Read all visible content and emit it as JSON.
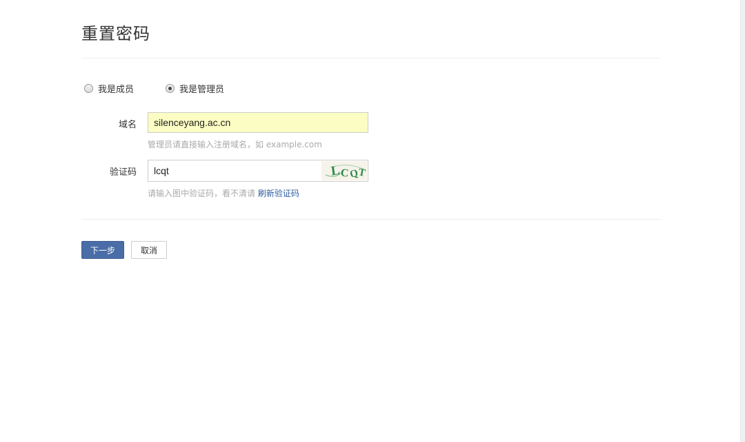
{
  "header": {
    "title": "重置密码"
  },
  "role_select": {
    "member_label": "我是成员",
    "admin_label": "我是管理员",
    "selected": "admin"
  },
  "domain_field": {
    "label": "域名",
    "value": "silenceyang.ac.cn",
    "hint": "管理员请直接输入注册域名，如 example.com"
  },
  "captcha_field": {
    "label": "验证码",
    "value": "lcqt",
    "hint": "请输入图中验证码，看不清请",
    "refresh_link": "刷新验证码",
    "image_text": "LCQT"
  },
  "actions": {
    "next_label": "下一步",
    "cancel_label": "取消"
  },
  "colors": {
    "primary_button": "#4a6da7",
    "autofill_background": "#fbfdc2",
    "link": "#2e5f9e",
    "captcha_green": "#2f8a4a"
  }
}
